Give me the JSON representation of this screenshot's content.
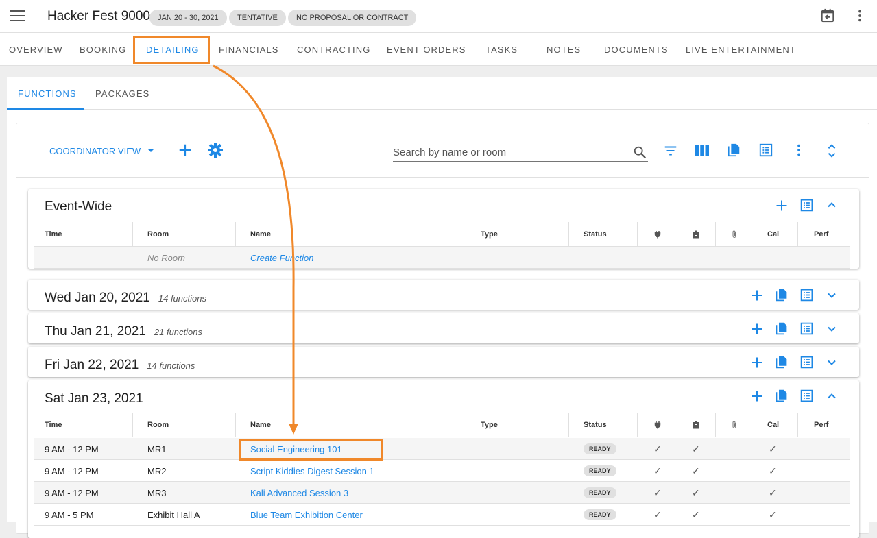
{
  "header": {
    "title": "Hacker Fest 9000",
    "chips": [
      "JAN 20 - 30, 2021",
      "TENTATIVE",
      "NO PROPOSAL OR CONTRACT"
    ]
  },
  "tabs": [
    "OVERVIEW",
    "BOOKING",
    "DETAILING",
    "FINANCIALS",
    "CONTRACTING",
    "EVENT ORDERS",
    "TASKS",
    "NOTES",
    "DOCUMENTS",
    "LIVE ENTERTAINMENT"
  ],
  "active_tab": "DETAILING",
  "subtabs": [
    "FUNCTIONS",
    "PACKAGES"
  ],
  "toolbar": {
    "view_label": "COORDINATOR VIEW",
    "search_placeholder": "Search by name or room"
  },
  "columns": {
    "time": "Time",
    "room": "Room",
    "name": "Name",
    "type": "Type",
    "status": "Status",
    "cal": "Cal",
    "perf": "Perf"
  },
  "event_wide": {
    "title": "Event-Wide",
    "row": {
      "room": "No Room",
      "name": "Create Function"
    }
  },
  "days": [
    {
      "title": "Wed Jan 20, 2021",
      "count": "14 functions"
    },
    {
      "title": "Thu Jan 21, 2021",
      "count": "21 functions"
    },
    {
      "title": "Fri Jan 22, 2021",
      "count": "14 functions"
    }
  ],
  "sat": {
    "title": "Sat Jan 23, 2021",
    "rows": [
      {
        "time": "9 AM - 12 PM",
        "room": "MR1",
        "name": "Social Engineering 101",
        "status": "READY"
      },
      {
        "time": "9 AM - 12 PM",
        "room": "MR2",
        "name": "Script Kiddies Digest Session 1",
        "status": "READY"
      },
      {
        "time": "9 AM - 12 PM",
        "room": "MR3",
        "name": "Kali Advanced Session 3",
        "status": "READY"
      },
      {
        "time": "9 AM - 5 PM",
        "room": "Exhibit Hall A",
        "name": "Blue Team Exhibition Center",
        "status": "READY"
      }
    ]
  },
  "icons": {
    "menu": "hamburger-menu-icon",
    "calendar": "calendar-back-icon",
    "more": "more-vert-icon",
    "add": "plus-icon",
    "settings": "gear-icon",
    "search": "search-icon",
    "filter": "filter-icon",
    "columns": "columns-icon",
    "copy": "copy-icon",
    "list": "list-icon",
    "expand": "unfold-icon",
    "plug": "plug-icon",
    "clipboard": "clipboard-icon",
    "attach": "paperclip-icon"
  },
  "colors": {
    "accent": "#1e88e5",
    "annotation": "#f0882a"
  }
}
